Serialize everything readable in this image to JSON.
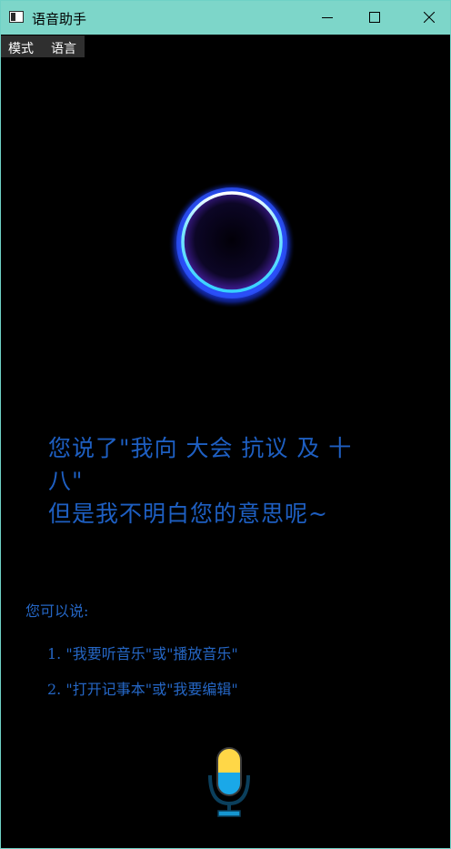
{
  "window": {
    "title": "语音助手",
    "icon": "app-window-icon",
    "controls": [
      "minimize-icon",
      "maximize-icon",
      "close-icon"
    ],
    "titlebar_color": "#7dd6c9"
  },
  "menu": {
    "items": [
      {
        "label": "模式"
      },
      {
        "label": "语言"
      }
    ]
  },
  "assistant": {
    "orb_icon": "glowing-ring-icon",
    "accent": "#1e5fc2",
    "reply_lines": [
      "您说了\"我向 大会 抗议 及 十",
      "八\"",
      "但是我不明白您的意思呢~"
    ],
    "hint_title": "您可以说:",
    "hints": [
      "1. \"我要听音乐\"或\"播放音乐\"",
      "2. \"打开记事本\"或\"我要编辑\""
    ],
    "mic_icon": "microphone-icon"
  }
}
